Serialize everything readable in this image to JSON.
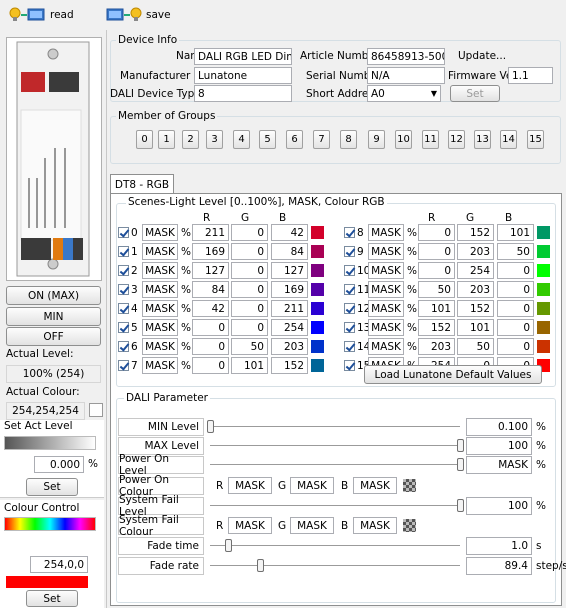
{
  "toolbar": {
    "read_label": "read",
    "save_label": "save"
  },
  "left": {
    "on_max": "ON (MAX)",
    "min": "MIN",
    "off": "OFF",
    "actual_level_label": "Actual Level:",
    "actual_level_value": "100% (254)",
    "actual_colour_label": "Actual Colour:",
    "actual_colour_value": "254,254,254",
    "set_act_level_label": "Set Act Level",
    "set_level_value": "0.000",
    "percent": "%",
    "set": "Set",
    "colour_control_label": "Colour Control",
    "colour_value": "254,0,0",
    "colour_set": "Set",
    "colour_preview": "#ff0000"
  },
  "device_info": {
    "legend": "Device Info",
    "name_label": "Name",
    "name_value": "DALI RGB LED Dim...",
    "manufacturer_label": "Manufacturer",
    "manufacturer_value": "Lunatone",
    "device_type_label": "DALI Device Type",
    "device_type_value": "8",
    "article_label": "Article Number",
    "article_value": "86458913-500",
    "serial_label": "Serial Number",
    "serial_value": "N/A",
    "short_label": "Short Address",
    "short_value": "A0",
    "update_label": "Update...",
    "firmware_label": "Firmware Ver",
    "firmware_value": "1.1",
    "set_label": "Set"
  },
  "groups": {
    "legend": "Member of Groups",
    "items": [
      "0",
      "1",
      "2",
      "3",
      "4",
      "5",
      "6",
      "7",
      "8",
      "9",
      "10",
      "11",
      "12",
      "13",
      "14",
      "15"
    ]
  },
  "tab": {
    "label": "DT8 - RGB"
  },
  "scenes": {
    "legend": "Scenes-Light Level [0..100%], MASK, Colour RGB",
    "col_r": "R",
    "col_g": "G",
    "col_b": "B",
    "rows": [
      {
        "n": "0",
        "level": "MASK",
        "p": "%",
        "r": "211",
        "g": "0",
        "b": "42",
        "c": "#d3002a"
      },
      {
        "n": "1",
        "level": "MASK",
        "p": "%",
        "r": "169",
        "g": "0",
        "b": "84",
        "c": "#a90054"
      },
      {
        "n": "2",
        "level": "MASK",
        "p": "%",
        "r": "127",
        "g": "0",
        "b": "127",
        "c": "#7f007f"
      },
      {
        "n": "3",
        "level": "MASK",
        "p": "%",
        "r": "84",
        "g": "0",
        "b": "169",
        "c": "#5400a9"
      },
      {
        "n": "4",
        "level": "MASK",
        "p": "%",
        "r": "42",
        "g": "0",
        "b": "211",
        "c": "#2a00d3"
      },
      {
        "n": "5",
        "level": "MASK",
        "p": "%",
        "r": "0",
        "g": "0",
        "b": "254",
        "c": "#0000fe"
      },
      {
        "n": "6",
        "level": "MASK",
        "p": "%",
        "r": "0",
        "g": "50",
        "b": "203",
        "c": "#0032cb"
      },
      {
        "n": "7",
        "level": "MASK",
        "p": "%",
        "r": "0",
        "g": "101",
        "b": "152",
        "c": "#006598"
      },
      {
        "n": "8",
        "level": "MASK",
        "p": "%",
        "r": "0",
        "g": "152",
        "b": "101",
        "c": "#009865"
      },
      {
        "n": "9",
        "level": "MASK",
        "p": "%",
        "r": "0",
        "g": "203",
        "b": "50",
        "c": "#00cb32"
      },
      {
        "n": "10",
        "level": "MASK",
        "p": "%",
        "r": "0",
        "g": "254",
        "b": "0",
        "c": "#00fe00"
      },
      {
        "n": "11",
        "level": "MASK",
        "p": "%",
        "r": "50",
        "g": "203",
        "b": "0",
        "c": "#32cb00"
      },
      {
        "n": "12",
        "level": "MASK",
        "p": "%",
        "r": "101",
        "g": "152",
        "b": "0",
        "c": "#659800"
      },
      {
        "n": "13",
        "level": "MASK",
        "p": "%",
        "r": "152",
        "g": "101",
        "b": "0",
        "c": "#986500"
      },
      {
        "n": "14",
        "level": "MASK",
        "p": "%",
        "r": "203",
        "g": "50",
        "b": "0",
        "c": "#cb3200"
      },
      {
        "n": "15",
        "level": "MASK",
        "p": "%",
        "r": "254",
        "g": "0",
        "b": "0",
        "c": "#fe0000"
      }
    ],
    "load_defaults": "Load Lunatone Default Values"
  },
  "dali": {
    "legend": "DALI Parameter",
    "min_label": "MIN Level",
    "min_value": "0.100",
    "min_unit": "%",
    "min_pos": 0.0,
    "max_label": "MAX Level",
    "max_value": "100",
    "max_unit": "%",
    "max_pos": 1.0,
    "pon_label": "Power On Level",
    "pon_value": "MASK",
    "pon_unit": "%",
    "pon_pos": 1.0,
    "pon_colour_label": "Power On Colour",
    "pon_colour": {
      "r": "R",
      "rv": "MASK",
      "g": "G",
      "gv": "MASK",
      "b": "B",
      "bv": "MASK"
    },
    "sf_label": "System Fail Level",
    "sf_value": "100",
    "sf_unit": "%",
    "sf_pos": 1.0,
    "sf_colour_label": "System Fail Colour",
    "sf_colour": {
      "r": "R",
      "rv": "MASK",
      "g": "G",
      "gv": "MASK",
      "b": "B",
      "bv": "MASK"
    },
    "fade_time_label": "Fade time",
    "fade_time_value": "1.0",
    "fade_time_unit": "s",
    "fade_time_pos": 0.07,
    "fade_rate_label": "Fade rate",
    "fade_rate_value": "89.4",
    "fade_rate_unit": "step/s",
    "fade_rate_pos": 0.2
  }
}
